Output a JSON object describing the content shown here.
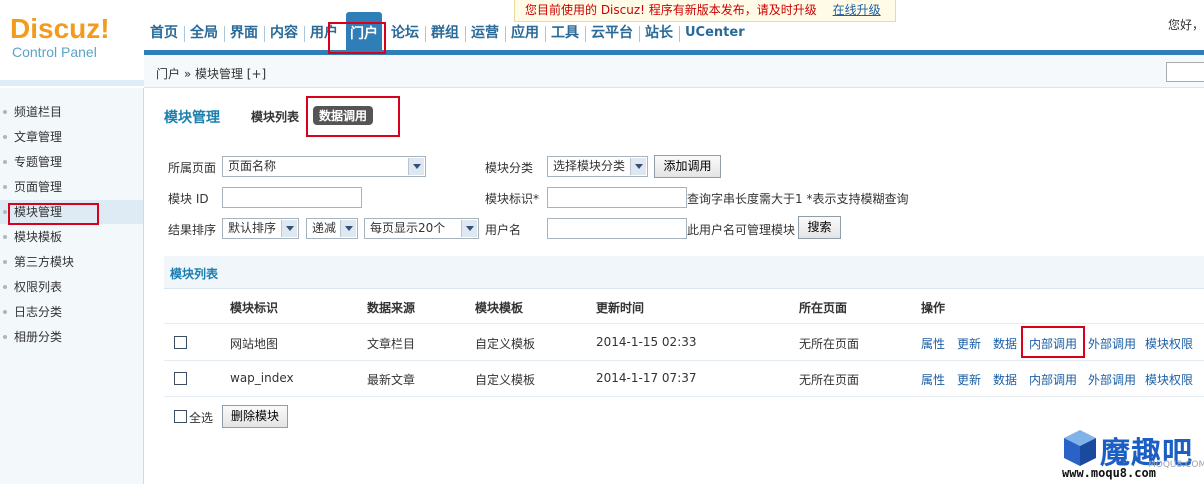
{
  "logo": {
    "main": "Discuz!",
    "sub": "Control Panel"
  },
  "notice": {
    "message": "您目前使用的 Discuz! 程序有新版本发布，请及时升级",
    "link": "在线升级"
  },
  "user_greeting": "您好，l",
  "nav": [
    "首页",
    "全局",
    "界面",
    "内容",
    "用户",
    "门户",
    "论坛",
    "群组",
    "运营",
    "应用",
    "工具",
    "云平台",
    "站长",
    "UCenter"
  ],
  "breadcrumb": "门户 » 模块管理  [+]",
  "sidebar": [
    "频道栏目",
    "文章管理",
    "专题管理",
    "页面管理",
    "模块管理",
    "模块模板",
    "第三方模块",
    "权限列表",
    "日志分类",
    "相册分类"
  ],
  "page": {
    "title": "模块管理",
    "tabs": [
      "模块列表",
      "数据调用"
    ]
  },
  "filters": {
    "page_label": "所属页面",
    "page_value": "页面名称",
    "category_label": "模块分类",
    "category_value": "选择模块分类",
    "add_button": "添加调用",
    "module_id_label": "模块 ID",
    "module_key_label": "模块标识*",
    "key_hint": "查询字串长度需大于1  *表示支持模糊查询",
    "sort_label": "结果排序",
    "sort_value": "默认排序",
    "order_value": "递减",
    "perpage_value": "每页显示20个",
    "username_label": "用户名",
    "username_hint": "此用户名可管理模块",
    "search_button": "搜索"
  },
  "list": {
    "section_title": "模块列表",
    "headers": [
      "模块标识",
      "数据来源",
      "模块模板",
      "更新时间",
      "所在页面",
      "操作"
    ],
    "rows": [
      {
        "name": "网站地图",
        "source": "文章栏目",
        "template": "自定义模板",
        "time": "2014-1-15 02:33",
        "page": "无所在页面"
      },
      {
        "name": "wap_index",
        "source": "最新文章",
        "template": "自定义模板",
        "time": "2014-1-17 07:37",
        "page": "无所在页面"
      }
    ],
    "actions": [
      "属性",
      "更新",
      "数据",
      "内部调用",
      "外部调用",
      "模块权限"
    ],
    "select_all": "全选",
    "delete_button": "删除模块"
  },
  "watermark": {
    "text": "魔趣吧",
    "url": "www.moqu8.com",
    "url_small": "MOQU8.COM"
  },
  "colors": {
    "accent": "#2f7eb8",
    "highlight": "#d9001b",
    "logo": "#f29b1d"
  }
}
